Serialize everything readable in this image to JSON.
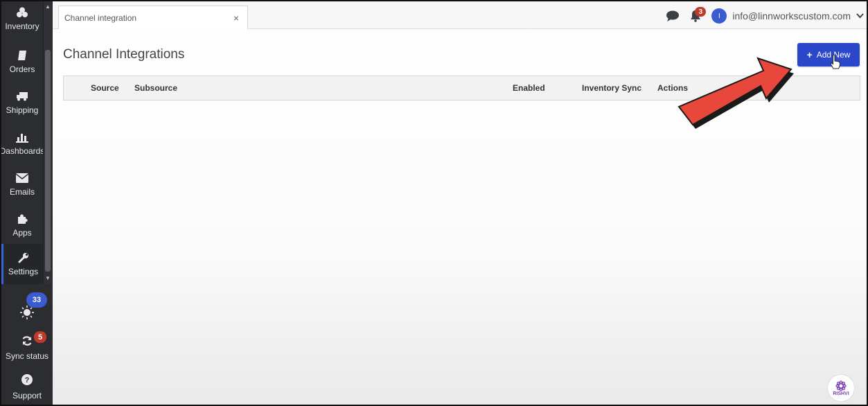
{
  "sidebar": {
    "items": [
      {
        "label": "Inventory",
        "icon": "boxes-icon"
      },
      {
        "label": "Orders",
        "icon": "orders-icon"
      },
      {
        "label": "Shipping",
        "icon": "truck-icon"
      },
      {
        "label": "Dashboards",
        "icon": "bar-chart-icon"
      },
      {
        "label": "Emails",
        "icon": "envelope-icon"
      },
      {
        "label": "Apps",
        "icon": "puzzle-icon"
      },
      {
        "label": "Settings",
        "icon": "wrench-icon"
      }
    ],
    "active": "Settings",
    "tips_badge": "33",
    "sync_label": "Sync status",
    "sync_badge": "5",
    "support_label": "Support"
  },
  "tab": {
    "title": "Channel integration",
    "close": "×"
  },
  "header": {
    "notifications_count": "3",
    "avatar_initial": "I",
    "email": "info@linnworkscustom.com"
  },
  "page": {
    "title": "Channel Integrations",
    "add_button": "Add New",
    "add_icon": "+"
  },
  "table": {
    "columns": [
      "Source",
      "Subsource",
      "Enabled",
      "Inventory Sync",
      "Actions"
    ]
  },
  "watermark": {
    "text": "RISHVI"
  },
  "colors": {
    "sidebar_bg": "#2b2d31",
    "accent": "#2a48c9",
    "badge_blue": "#3b5bd0",
    "badge_red": "#c0392b",
    "arrow_red": "#e8473b"
  }
}
